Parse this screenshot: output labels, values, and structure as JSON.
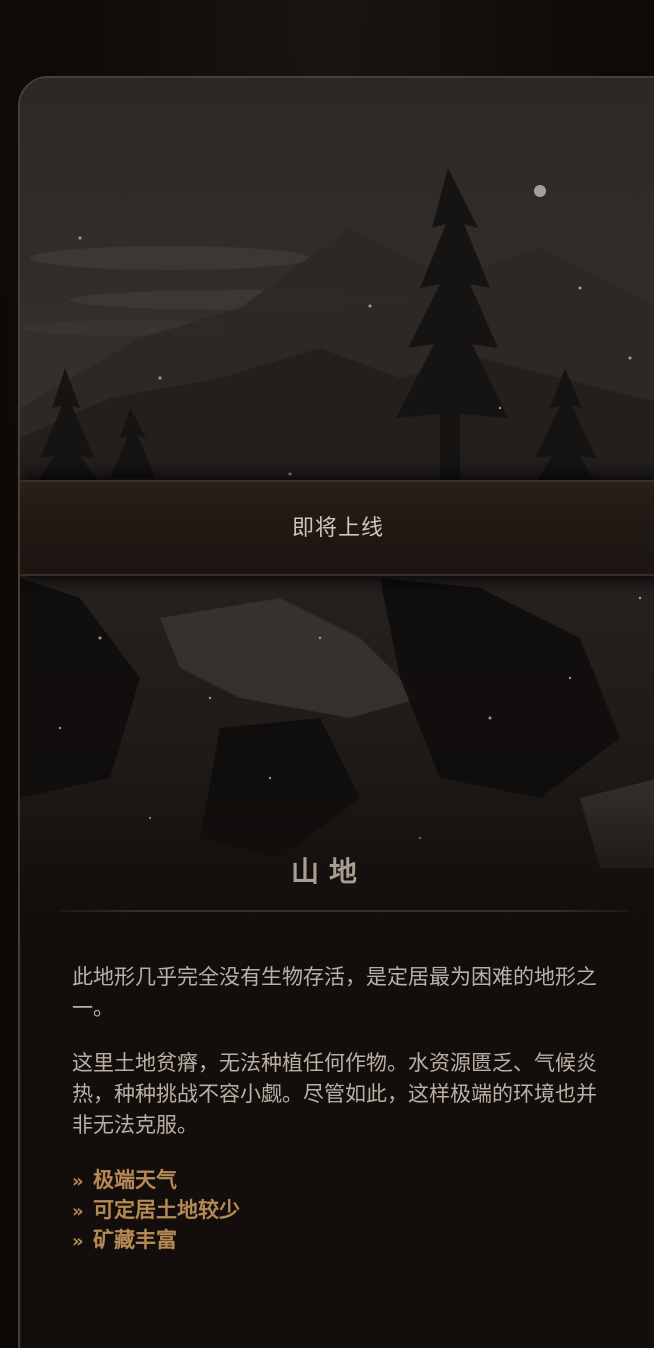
{
  "card": {
    "banner_label": "即将上线",
    "title": "山地",
    "description_1": "此地形几乎完全没有生物存活，是定居最为困难的地形之一。",
    "description_2": "这里土地贫瘠，无法种植任何作物。水资源匮乏、气候炎热，种种挑战不容小觑。尽管如此，这样极端的环境也并非无法克服。",
    "features": [
      "极端天气",
      "可定居土地较少",
      "矿藏丰富"
    ],
    "bullet_glyph": "»"
  },
  "colors": {
    "background": "#100b09",
    "card_border": "#4a3d33",
    "banner_text": "#cfc5b8",
    "title_text": "#a89e92",
    "body_text": "#b9b0a5",
    "feature_text": "#b58a54"
  }
}
